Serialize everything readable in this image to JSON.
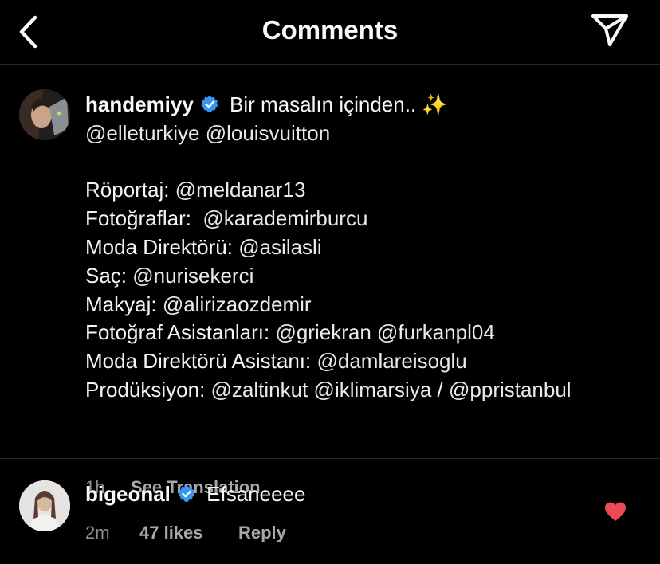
{
  "header": {
    "title": "Comments",
    "back_icon": "chevron-left-icon",
    "share_icon": "paper-plane-icon"
  },
  "caption": {
    "username": "handemiyy",
    "verified": true,
    "first_text": " Bir masalın içinden.. ",
    "sparkle": "✨",
    "mentions_line": [
      "@elleturkiye",
      "@louisvuitton"
    ],
    "credits": [
      {
        "label": "Röportaj: ",
        "mentions": [
          "@meldanar13"
        ]
      },
      {
        "label": "Fotoğraflar:  ",
        "mentions": [
          "@karademirburcu"
        ]
      },
      {
        "label": "Moda Direktörü: ",
        "mentions": [
          "@asilasli"
        ]
      },
      {
        "label": "Saç: ",
        "mentions": [
          "@nurisekerci"
        ]
      },
      {
        "label": "Makyaj: ",
        "mentions": [
          "@alirizaozdemir"
        ]
      },
      {
        "label": "Fotoğraf Asistanları: ",
        "mentions": [
          "@griekran",
          "@furkanpl04"
        ]
      },
      {
        "label": "Moda Direktörü Asistanı: ",
        "mentions": [
          "@damlareisoglu"
        ]
      },
      {
        "label": "Prodüksiyon: ",
        "mentions": [
          "@zaltinkut",
          "@iklimarsiya",
          "/",
          "@ppristanbul"
        ]
      }
    ],
    "time": "1h",
    "see_translation": "See Translation"
  },
  "comment": {
    "username": "bigeonal",
    "verified": true,
    "text": " Efsaneeee",
    "time": "2m",
    "likes": "47 likes",
    "reply": "Reply",
    "liked": true
  },
  "colors": {
    "verified": "#3897f0",
    "heart": "#ed4956",
    "muted": "#8e8e8e"
  }
}
